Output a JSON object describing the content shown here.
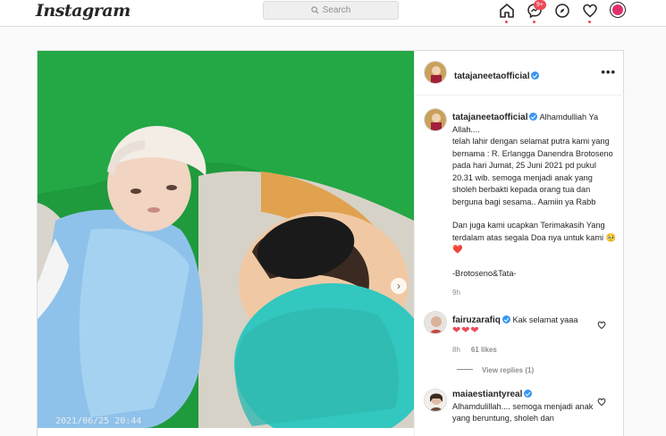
{
  "topbar": {
    "logo": "Instagram",
    "search_placeholder": "Search",
    "messages_badge": "9+"
  },
  "post": {
    "photo_timestamp": "2021/06/25 20:44",
    "author": "tatajaneetaofficial",
    "caption": {
      "username": "tatajaneetaofficial",
      "line1": "Alhamdulliah Ya Allah....",
      "para1": "telah lahir dengan selamat putra kami yang bernama : R. Erlangga Danendra Brotoseno pada hari Jumat, 25 Juni 2021 pd pukul 20.31 wib. semoga menjadi anak yang sholeh berbakti kepada orang tua dan berguna bagi sesama.. Aamiin ya Rabb",
      "para2": "Dan juga kami ucapkan Terimakasih Yang terdalam atas segala Doa nya untuk kami 🥺❤️",
      "signature": "-Brotoseno&Tata-",
      "time": "9h"
    },
    "comments": [
      {
        "username": "fairuzarafiq",
        "text": "Kak selamat yaaa",
        "hearts": "❤❤❤",
        "time": "8h",
        "likes": "61 likes",
        "view_replies": "View replies (1)"
      },
      {
        "username": "maiaestiantyreal",
        "text": "Alhamdulillah.... semoga menjadi anak yang beruntung, sholeh dan"
      }
    ]
  },
  "colors": {
    "brand_red": "#ed4956",
    "verified_blue": "#3897f0",
    "text": "#262626",
    "muted": "#8e8e8e"
  }
}
